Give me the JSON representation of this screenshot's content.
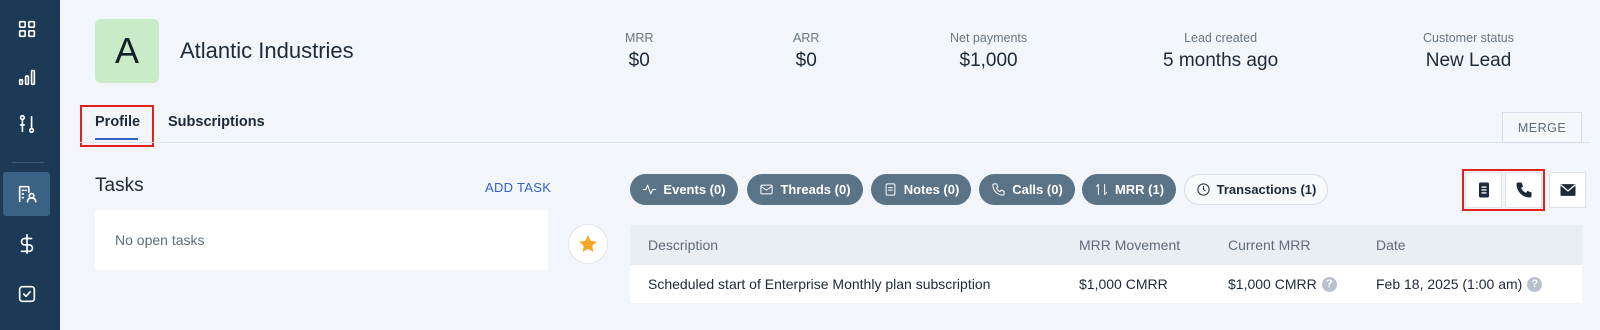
{
  "sidebar": {
    "items": [
      {
        "icon": "grid-icon"
      },
      {
        "icon": "bar-chart-icon"
      },
      {
        "icon": "pipeline-icon"
      },
      {
        "icon": "customers-icon",
        "active": true
      },
      {
        "icon": "dollar-icon"
      },
      {
        "icon": "task-check-icon"
      }
    ]
  },
  "customer": {
    "avatar_letter": "A",
    "name": "Atlantic Industries"
  },
  "metrics": [
    {
      "label": "MRR",
      "value": "$0"
    },
    {
      "label": "ARR",
      "value": "$0"
    },
    {
      "label": "Net payments",
      "value": "$1,000"
    },
    {
      "label": "Lead created",
      "value": "5 months ago"
    },
    {
      "label": "Customer status",
      "value": "New Lead"
    }
  ],
  "tabs": [
    {
      "label": "Profile",
      "active": true
    },
    {
      "label": "Subscriptions",
      "active": false
    }
  ],
  "merge_label": "MERGE",
  "tasks": {
    "title": "Tasks",
    "add_label": "ADD TASK",
    "empty_text": "No open tasks"
  },
  "filters": [
    {
      "label": "Events (0)",
      "icon": "activity-icon"
    },
    {
      "label": "Threads (0)",
      "icon": "mail-icon"
    },
    {
      "label": "Notes (0)",
      "icon": "note-icon"
    },
    {
      "label": "Calls (0)",
      "icon": "phone-icon"
    },
    {
      "label": "MRR (1)",
      "icon": "arrows-updown-icon"
    },
    {
      "label": "Transactions (1)",
      "icon": "clock-icon",
      "selected": true
    }
  ],
  "table": {
    "headers": [
      "Description",
      "MRR Movement",
      "Current MRR",
      "Date"
    ],
    "rows": [
      {
        "description": "Scheduled start of Enterprise Monthly plan subscription",
        "movement": "$1,000 CMRR",
        "current": "$1,000 CMRR",
        "date": "Feb 18, 2025 (1:00 am)"
      }
    ]
  },
  "colors": {
    "sidebar": "#1c3a55",
    "accent": "#2f62c7",
    "pill": "#5a7386",
    "highlight_box": "#e32020",
    "star": "#f5a623"
  }
}
